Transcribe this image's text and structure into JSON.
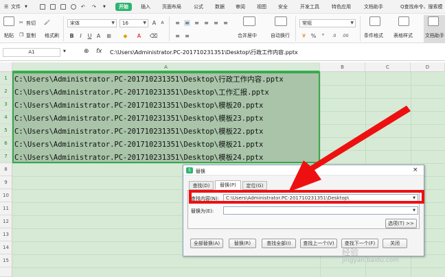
{
  "menubar": {
    "file_label": "文件",
    "tabs": [
      "开始",
      "插入",
      "页面布局",
      "公式",
      "数据",
      "审阅",
      "视图",
      "安全",
      "开发工具",
      "特色应用",
      "文档助手"
    ],
    "search_label": "Q查找命令、搜索模"
  },
  "ribbon": {
    "paste_label": "粘贴",
    "cut_label": "剪切",
    "copy_label": "复制",
    "format_painter_label": "格式刷",
    "font_name": "宋体",
    "font_size": "16",
    "merge_label": "合并居中",
    "wrap_label": "自动换行",
    "number_format": "常规",
    "cond_format_label": "条件格式",
    "table_style_label": "表格样式",
    "doc_helper_label": "文档助手"
  },
  "formula_bar": {
    "cell_ref": "A1",
    "fx_label": "fx",
    "value": "C:\\Users\\Administrator.PC-201710231351\\Desktop\\行政工作内容.pptx"
  },
  "grid": {
    "columns": [
      "A",
      "B",
      "C",
      "D"
    ],
    "rows": [
      "1",
      "2",
      "3",
      "4",
      "5",
      "6",
      "7",
      "8",
      "9",
      "10",
      "11",
      "12",
      "13",
      "14",
      "15"
    ],
    "cells": [
      "C:\\Users\\Administrator.PC-201710231351\\Desktop\\行政工作内容.pptx",
      "C:\\Users\\Administrator.PC-201710231351\\Desktop\\工作汇报.pptx",
      "C:\\Users\\Administrator.PC-201710231351\\Desktop\\模板20.pptx",
      "C:\\Users\\Administrator.PC-201710231351\\Desktop\\模板23.pptx",
      "C:\\Users\\Administrator.PC-201710231351\\Desktop\\模板22.pptx",
      "C:\\Users\\Administrator.PC-201710231351\\Desktop\\模板21.pptx",
      "C:\\Users\\Administrator.PC-201710231351\\Desktop\\模板24.pptx"
    ]
  },
  "dialog": {
    "title": "替换",
    "tabs": [
      "查找(D)",
      "替换(P)",
      "定位(G)"
    ],
    "find_label": "查找内容(N):",
    "find_value": "C:\\Users\\Administrator.PC-201710231351\\Desktop\\",
    "replace_label": "替换为(E):",
    "replace_value": "",
    "options_label": "选项(T) >>",
    "buttons": [
      "全部替换(A)",
      "替换(R)",
      "查找全部(I)",
      "查找上一个(V)",
      "查找下一个(F)",
      "关闭"
    ]
  },
  "watermark": {
    "line1": "经验",
    "line2": "jingyan.baidu.com"
  },
  "colors": {
    "accent": "#2db56e",
    "selection_fill": "#a9c4a9",
    "selection_border": "#36a84c",
    "highlight_box": "#ee1010",
    "arrow": "#ee1010"
  }
}
